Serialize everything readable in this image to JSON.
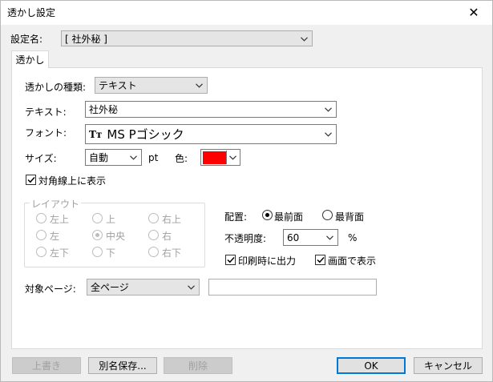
{
  "window": {
    "title": "透かし設定",
    "close_glyph": "✕"
  },
  "setting_name": {
    "label": "設定名:",
    "value": "[ 社外秘 ]"
  },
  "tab": {
    "label": "透かし"
  },
  "watermark_type": {
    "label": "透かしの種類:",
    "value": "テキスト"
  },
  "text": {
    "label": "テキスト:",
    "value": "社外秘"
  },
  "font": {
    "label": "フォント:",
    "glyph": "Tт",
    "value": "MS Pゴシック"
  },
  "size": {
    "label": "サイズ:",
    "value": "自動",
    "unit": "pt"
  },
  "color": {
    "label": "色:",
    "value": "#ff0000"
  },
  "diagonal": {
    "label": "対角線上に表示",
    "checked": true
  },
  "layout": {
    "legend": "レイアウト",
    "options": [
      {
        "label": "左上",
        "selected": false
      },
      {
        "label": "上",
        "selected": false
      },
      {
        "label": "右上",
        "selected": false
      },
      {
        "label": "左",
        "selected": false
      },
      {
        "label": "中央",
        "selected": true
      },
      {
        "label": "右",
        "selected": false
      },
      {
        "label": "左下",
        "selected": false
      },
      {
        "label": "下",
        "selected": false
      },
      {
        "label": "右下",
        "selected": false
      }
    ]
  },
  "placement": {
    "label": "配置:",
    "front": {
      "label": "最前面",
      "selected": true
    },
    "back": {
      "label": "最背面",
      "selected": false
    }
  },
  "opacity": {
    "label": "不透明度:",
    "value": "60",
    "unit": "%"
  },
  "print_output": {
    "label": "印刷時に出力",
    "checked": true
  },
  "screen_display": {
    "label": "画面で表示",
    "checked": true
  },
  "target_pages": {
    "label": "対象ページ:",
    "value": "全ページ",
    "range": ""
  },
  "buttons": {
    "overwrite": "上書き",
    "save_as": "別名保存...",
    "delete": "削除",
    "ok": "OK",
    "cancel": "キャンセル"
  }
}
